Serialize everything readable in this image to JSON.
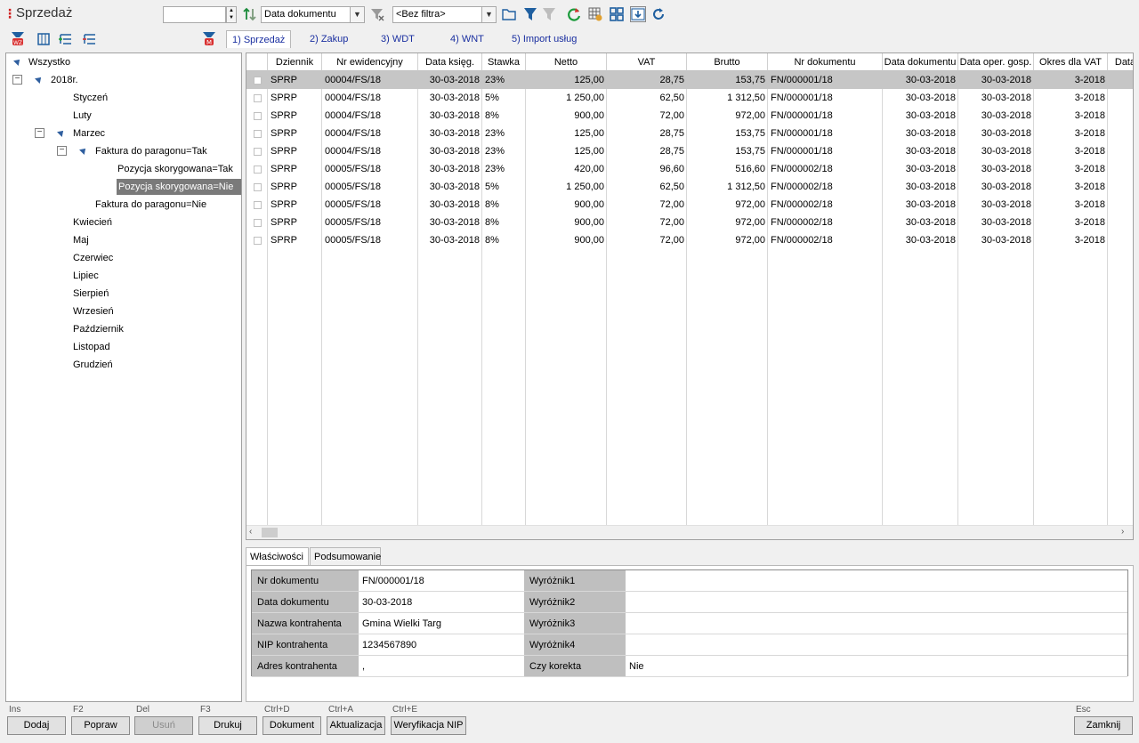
{
  "window": {
    "title": "Sprzedaż"
  },
  "toolbar": {
    "spin_value": "",
    "sort_field": "Data dokumentu",
    "filter": "<Bez filtra>"
  },
  "tabs": [
    {
      "label": "1) Sprzedaż",
      "active": true
    },
    {
      "label": "2) Zakup"
    },
    {
      "label": "3) WDT"
    },
    {
      "label": "4) WNT"
    },
    {
      "label": "5) Import usług"
    }
  ],
  "tree": {
    "root": "Wszystko",
    "year": "2018r.",
    "months": [
      "Styczeń",
      "Luty",
      "Marzec",
      "Kwiecień",
      "Maj",
      "Czerwiec",
      "Lipiec",
      "Sierpień",
      "Wrzesień",
      "Październik",
      "Listopad",
      "Grudzień"
    ],
    "faktura_tak": "Faktura do paragonu=Tak",
    "pozycja_tak": "Pozycja skorygowana=Tak",
    "pozycja_nie": "Pozycja skorygowana=Nie",
    "faktura_nie": "Faktura do paragonu=Nie"
  },
  "grid": {
    "columns": [
      "Dziennik",
      "Nr ewidencyjny",
      "Data księg.",
      "Stawka",
      "Netto",
      "VAT",
      "Brutto",
      "Nr dokumentu",
      "Data dokumentu",
      "Data oper. gosp.",
      "Okres dla VAT",
      "Data"
    ],
    "rows": [
      [
        "SPRP",
        "00004/FS/18",
        "30-03-2018",
        "23%",
        "125,00",
        "28,75",
        "153,75",
        "FN/000001/18",
        "30-03-2018",
        "30-03-2018",
        "3-2018"
      ],
      [
        "SPRP",
        "00004/FS/18",
        "30-03-2018",
        "5%",
        "1 250,00",
        "62,50",
        "1 312,50",
        "FN/000001/18",
        "30-03-2018",
        "30-03-2018",
        "3-2018"
      ],
      [
        "SPRP",
        "00004/FS/18",
        "30-03-2018",
        "8%",
        "900,00",
        "72,00",
        "972,00",
        "FN/000001/18",
        "30-03-2018",
        "30-03-2018",
        "3-2018"
      ],
      [
        "SPRP",
        "00004/FS/18",
        "30-03-2018",
        "23%",
        "125,00",
        "28,75",
        "153,75",
        "FN/000001/18",
        "30-03-2018",
        "30-03-2018",
        "3-2018"
      ],
      [
        "SPRP",
        "00004/FS/18",
        "30-03-2018",
        "23%",
        "125,00",
        "28,75",
        "153,75",
        "FN/000001/18",
        "30-03-2018",
        "30-03-2018",
        "3-2018"
      ],
      [
        "SPRP",
        "00005/FS/18",
        "30-03-2018",
        "23%",
        "420,00",
        "96,60",
        "516,60",
        "FN/000002/18",
        "30-03-2018",
        "30-03-2018",
        "3-2018"
      ],
      [
        "SPRP",
        "00005/FS/18",
        "30-03-2018",
        "5%",
        "1 250,00",
        "62,50",
        "1 312,50",
        "FN/000002/18",
        "30-03-2018",
        "30-03-2018",
        "3-2018"
      ],
      [
        "SPRP",
        "00005/FS/18",
        "30-03-2018",
        "8%",
        "900,00",
        "72,00",
        "972,00",
        "FN/000002/18",
        "30-03-2018",
        "30-03-2018",
        "3-2018"
      ],
      [
        "SPRP",
        "00005/FS/18",
        "30-03-2018",
        "8%",
        "900,00",
        "72,00",
        "972,00",
        "FN/000002/18",
        "30-03-2018",
        "30-03-2018",
        "3-2018"
      ],
      [
        "SPRP",
        "00005/FS/18",
        "30-03-2018",
        "8%",
        "900,00",
        "72,00",
        "972,00",
        "FN/000002/18",
        "30-03-2018",
        "30-03-2018",
        "3-2018"
      ]
    ]
  },
  "props_tabs": [
    "Właściwości",
    "Podsumowanie"
  ],
  "props": {
    "left": [
      {
        "label": "Nr dokumentu",
        "value": "FN/000001/18"
      },
      {
        "label": "Data dokumentu",
        "value": "30-03-2018"
      },
      {
        "label": "Nazwa kontrahenta",
        "value": "Gmina Wielki Targ"
      },
      {
        "label": "NIP kontrahenta",
        "value": "1234567890"
      },
      {
        "label": "Adres kontrahenta",
        "value": ","
      }
    ],
    "right": [
      {
        "label": "Wyróżnik1",
        "value": ""
      },
      {
        "label": "Wyróżnik2",
        "value": ""
      },
      {
        "label": "Wyróżnik3",
        "value": ""
      },
      {
        "label": "Wyróżnik4",
        "value": ""
      },
      {
        "label": "Czy korekta",
        "value": "Nie"
      }
    ]
  },
  "buttons": [
    {
      "shortcut": "Ins",
      "label": "Dodaj"
    },
    {
      "shortcut": "F2",
      "label": "Popraw"
    },
    {
      "shortcut": "Del",
      "label": "Usuń",
      "disabled": true
    },
    {
      "shortcut": "F3",
      "label": "Drukuj"
    },
    {
      "shortcut": "Ctrl+D",
      "label": "Dokument"
    },
    {
      "shortcut": "Ctrl+A",
      "label": "Aktualizacja"
    },
    {
      "shortcut": "Ctrl+E",
      "label": "Weryfikacja NIP"
    },
    {
      "shortcut": "Esc",
      "label": "Zamknij"
    }
  ],
  "colors": {
    "accent_red": "#d02020",
    "link_blue": "#1a2fa0",
    "selection": "#c6c6c6"
  }
}
